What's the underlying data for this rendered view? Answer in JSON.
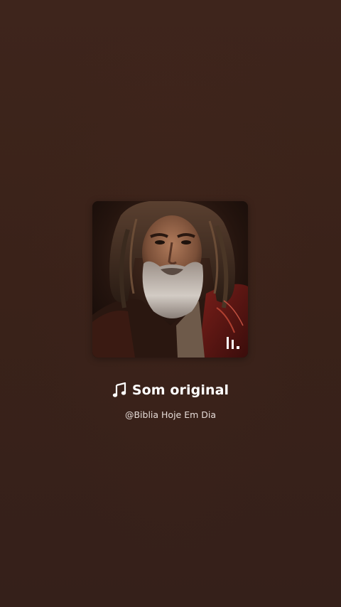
{
  "audio": {
    "title": "Som original",
    "author": "@Biblia Hoje Em Dia",
    "note_icon": "music-note-icon",
    "cover_logo_icon": "app-bars-logo-icon"
  },
  "colors": {
    "background": "#3a2219",
    "text_primary": "#ffffff",
    "text_secondary": "#e6dcd8"
  }
}
